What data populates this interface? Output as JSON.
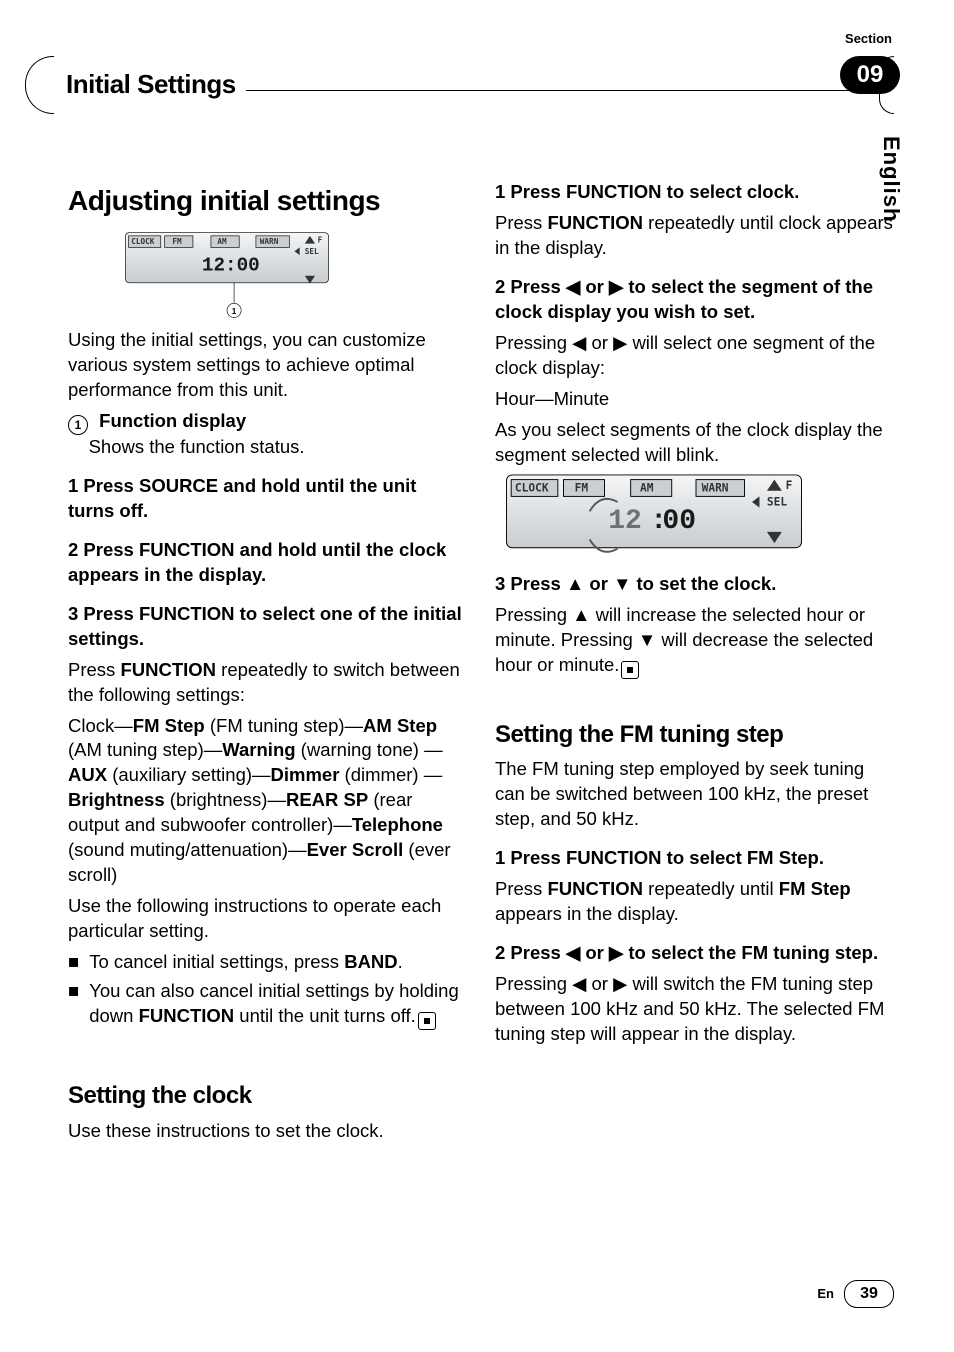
{
  "header": {
    "title": "Initial Settings",
    "section_word": "Section",
    "section_num": "09"
  },
  "lang_tab": "English",
  "lcd": {
    "clock": "CLOCK",
    "fm": "FM",
    "am": "AM",
    "warn": "WARN",
    "sel": "SEL",
    "f": "F",
    "time": "12:00",
    "hours": "12",
    "minutes": "00"
  },
  "left": {
    "h1": "Adjusting initial settings",
    "callout_label": "1",
    "intro": "Using the initial settings, you can customize various system settings to achieve optimal performance from this unit.",
    "fn_num": "①",
    "fn_title": "Function display",
    "fn_body": "Shows the function status.",
    "s1": "1   Press SOURCE and hold until the unit turns off.",
    "s2": "2   Press FUNCTION and hold until the clock appears in the display.",
    "s3": "3   Press FUNCTION to select one of the initial settings.",
    "s3_intro_a": "Press ",
    "s3_intro_b": "FUNCTION",
    "s3_intro_c": " repeatedly to switch between the following settings:",
    "chain": {
      "pre": "Clock—",
      "fm": "FM Step",
      "fm_d": " (FM tuning step)—",
      "am": "AM Step",
      "am_d": " (AM tuning step)—",
      "warn": "Warning",
      "warn_d": " (warning tone) —",
      "aux": "AUX",
      "aux_d": " (auxiliary setting)—",
      "dim": "Dimmer",
      "dim_d": " (dimmer) —",
      "br": "Brightness",
      "br_d": " (brightness)—",
      "rsp": "REAR SP",
      "rsp_d": " (rear output and subwoofer controller)—",
      "tel": "Telephone",
      "tel_d": " (sound muting/attenuation)—",
      "es": "Ever Scroll",
      "es_d": " (ever scroll)"
    },
    "post": "Use the following instructions to operate each particular setting.",
    "bul1_a": "To cancel initial settings, press ",
    "bul1_b": "BAND",
    "bul1_c": ".",
    "bul2_a": "You can also cancel initial settings by holding down ",
    "bul2_b": "FUNCTION",
    "bul2_c": " until the unit turns off.",
    "h2": "Setting the clock",
    "h2_body": "Use these instructions to set the clock."
  },
  "right": {
    "s1": "1   Press FUNCTION to select clock.",
    "s1_a": "Press ",
    "s1_b": "FUNCTION",
    "s1_c": " repeatedly until clock appears in the display.",
    "s2": "2   Press ◀ or ▶ to select the segment of the clock display you wish to set.",
    "s2_body": "Pressing ◀ or ▶ will select one segment of the clock display:",
    "s2_list": "Hour—Minute",
    "s2_tail": "As you select segments of the clock display the segment selected will blink.",
    "s3": "3   Press ▲ or ▼ to set the clock.",
    "s3_body": "Pressing ▲ will increase the selected hour or minute. Pressing ▼ will decrease the selected hour or minute.",
    "h2": "Setting the FM tuning step",
    "h2_body": "The FM tuning step employed by seek tuning can be switched between 100 kHz, the preset step, and 50 kHz.",
    "fs1": "1   Press FUNCTION to select FM Step.",
    "fs1_a": "Press ",
    "fs1_b": "FUNCTION",
    "fs1_c": " repeatedly until ",
    "fs1_d": "FM Step",
    "fs1_e": " appears in the display.",
    "fs2": "2   Press ◀ or ▶ to select the FM tuning step.",
    "fs2_body": "Pressing ◀ or ▶ will switch the FM tuning step between 100 kHz and 50 kHz. The selected FM tuning step will appear in the display."
  },
  "footer": {
    "lang": "En",
    "page": "39"
  }
}
